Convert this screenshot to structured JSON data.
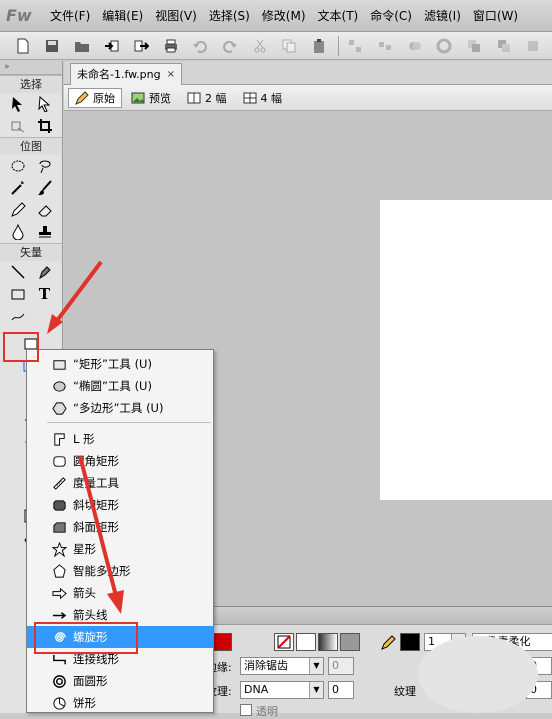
{
  "app": {
    "logo": "Fw"
  },
  "menubar": {
    "items": [
      "文件(F)",
      "编辑(E)",
      "视图(V)",
      "选择(S)",
      "修改(M)",
      "文本(T)",
      "命令(C)",
      "滤镜(I)",
      "窗口(W)"
    ]
  },
  "toolbar": {
    "icons": [
      "new-file-icon",
      "save-icon",
      "open-icon",
      "import-icon",
      "export-icon",
      "print-icon",
      "undo-icon",
      "redo-icon",
      "cut-icon",
      "copy-icon",
      "paste-icon",
      "group-icon",
      "ungroup-icon",
      "join-icon",
      "split-icon",
      "bring-front-icon",
      "send-back-icon",
      "align-icon"
    ]
  },
  "tools": {
    "sections": {
      "select": "选择",
      "bitmap": "位图",
      "vector": "矢量"
    },
    "text_tool": "T"
  },
  "document": {
    "tab_title": "未命名-1.fw.png",
    "tab_close": "×",
    "views": [
      {
        "label": "原始",
        "active": true
      },
      {
        "label": "预览",
        "active": false
      },
      {
        "label": "2 幅",
        "active": false
      },
      {
        "label": "4 幅",
        "active": false
      }
    ]
  },
  "flyout": {
    "items": [
      {
        "label": "“矩形”工具 (U)",
        "icon": "rectangle-icon",
        "selected": false
      },
      {
        "label": "“椭圆”工具 (U)",
        "icon": "ellipse-icon",
        "selected": false
      },
      {
        "label": "“多边形”工具 (U)",
        "icon": "polygon-icon",
        "selected": false
      },
      {
        "label": "L 形",
        "icon": "l-shape-icon",
        "selected": false
      },
      {
        "label": "圆角矩形",
        "icon": "rounded-rectangle-icon",
        "selected": false
      },
      {
        "label": "度量工具",
        "icon": "measure-tool-icon",
        "selected": false
      },
      {
        "label": "斜切矩形",
        "icon": "bevel-rectangle-icon",
        "selected": false
      },
      {
        "label": "斜面矩形",
        "icon": "chamfer-rectangle-icon",
        "selected": false
      },
      {
        "label": "星形",
        "icon": "star-icon",
        "selected": false
      },
      {
        "label": "智能多边形",
        "icon": "smart-polygon-icon",
        "selected": false
      },
      {
        "label": "箭头",
        "icon": "arrow-icon",
        "selected": false
      },
      {
        "label": "箭头线",
        "icon": "arrow-line-icon",
        "selected": false
      },
      {
        "label": "螺旋形",
        "icon": "spiral-icon",
        "selected": true
      },
      {
        "label": "连接线形",
        "icon": "connector-icon",
        "selected": false
      },
      {
        "label": "面圆形",
        "icon": "donut-icon",
        "selected": false
      },
      {
        "label": "饼形",
        "icon": "pie-icon",
        "selected": false
      }
    ]
  },
  "properties": {
    "fill_color": "#cc0000",
    "stroke_color": "#000000",
    "stroke_size": "1",
    "stroke_type": "1 像素柔化",
    "edge_label": "边缘:",
    "edge_value": "消除锯齿",
    "edge_amount": "0",
    "texture_label": "纹理:",
    "texture_value": "DNA",
    "texture_amount": "0",
    "transparent_label": "透明",
    "right_texture_label": "纹理",
    "right_value_1": "0",
    "right_value_2": "0"
  }
}
